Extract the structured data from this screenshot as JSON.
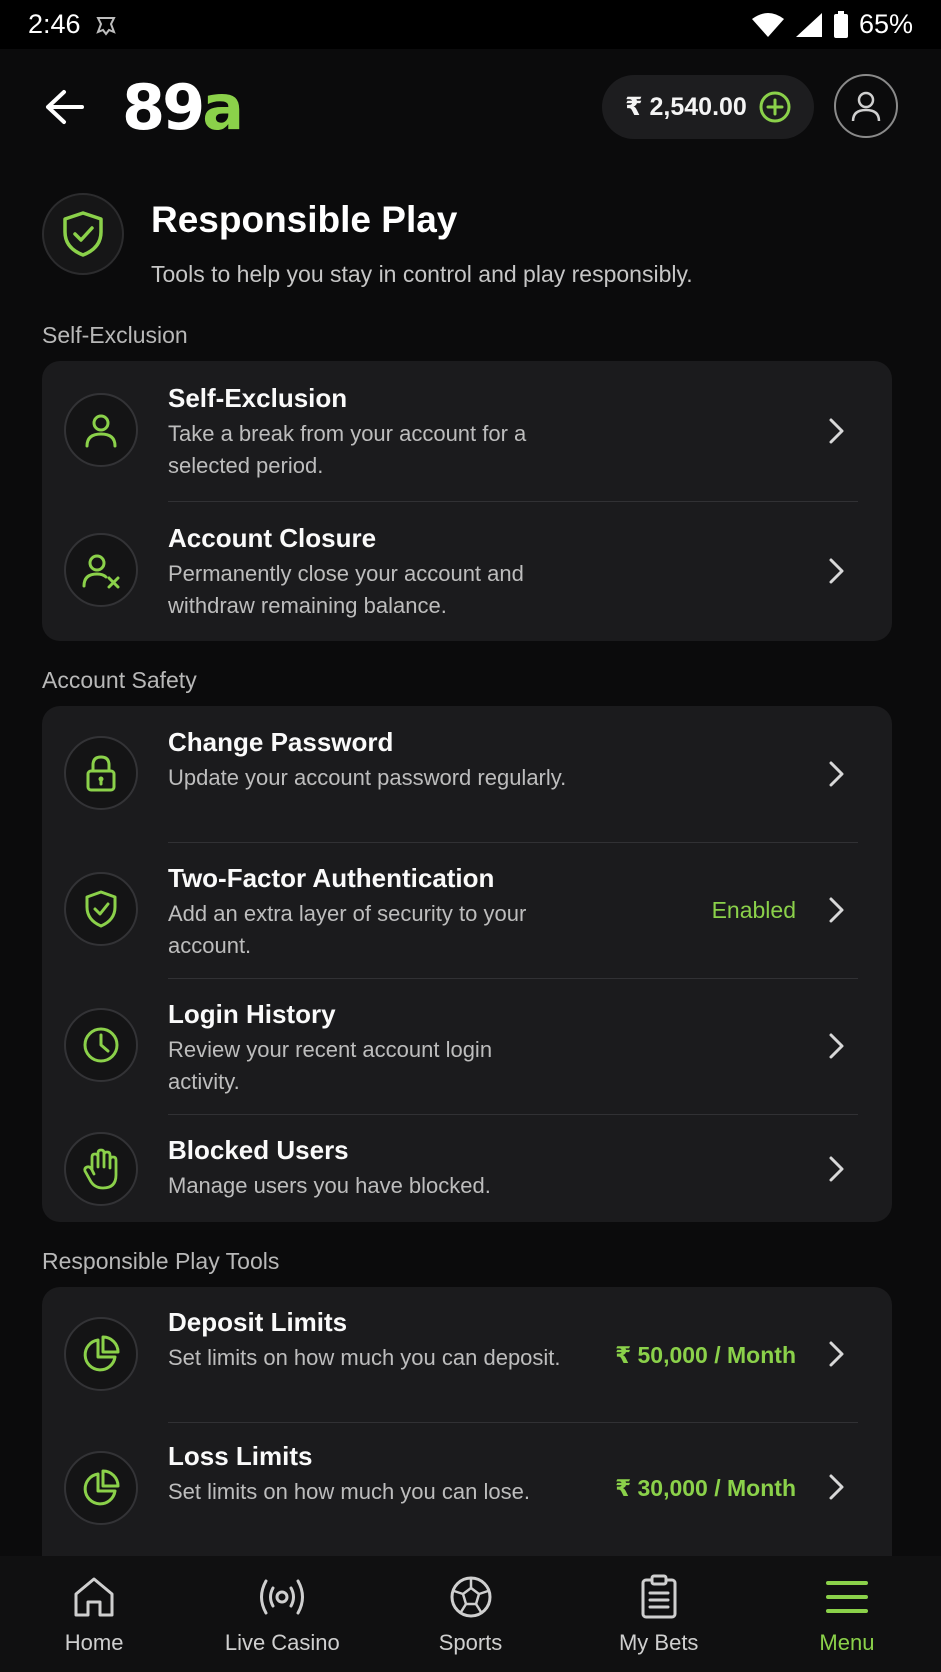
{
  "status_bar": {
    "time": "2:46",
    "battery": "65%"
  },
  "header": {
    "logo_main": "89",
    "logo_accent": "a",
    "balance": "₹ 2,540.00"
  },
  "page": {
    "title": "Responsible Play",
    "subtitle": "Tools to help you stay in control and play responsibly."
  },
  "sections": [
    {
      "label": "Self-Exclusion",
      "items": [
        {
          "title": "Self-Exclusion",
          "desc": "Take a break from your account for a selected period.",
          "icon": "person-icon"
        },
        {
          "title": "Account Closure",
          "desc": "Permanently close your account and withdraw remaining balance.",
          "icon": "person-remove-icon"
        }
      ]
    },
    {
      "label": "Account Safety",
      "items": [
        {
          "title": "Change Password",
          "desc": "Update your account password regularly.",
          "icon": "lock-icon"
        },
        {
          "title": "Two-Factor Authentication",
          "desc": "Add an extra layer of security to your account.",
          "value": "Enabled",
          "icon": "shield-check-icon"
        },
        {
          "title": "Login History",
          "desc": "Review your recent account login activity.",
          "icon": "clock-icon"
        },
        {
          "title": "Blocked Users",
          "desc": "Manage users you have blocked.",
          "icon": "hand-icon"
        }
      ]
    },
    {
      "label": "Responsible Play Tools",
      "items": [
        {
          "title": "Deposit Limits",
          "desc": "Set limits on how much you can deposit.",
          "value": "₹ 50,000 / Month",
          "icon": "pie-chart-icon"
        },
        {
          "title": "Loss Limits",
          "desc": "Set limits on how much you can lose.",
          "value": "₹ 30,000 / Month",
          "icon": "pie-chart-icon"
        }
      ]
    }
  ],
  "bottom_nav": [
    {
      "label": "Home",
      "icon": "home-icon",
      "active": false
    },
    {
      "label": "Live Casino",
      "icon": "broadcast-icon",
      "active": false
    },
    {
      "label": "Sports",
      "icon": "soccer-ball-icon",
      "active": false
    },
    {
      "label": "My Bets",
      "icon": "clipboard-icon",
      "active": false
    },
    {
      "label": "Menu",
      "icon": "menu-icon",
      "active": true
    }
  ],
  "colors": {
    "accent": "#8bd14a",
    "background": "#0b0b0c",
    "card": "#1b1b1d"
  }
}
